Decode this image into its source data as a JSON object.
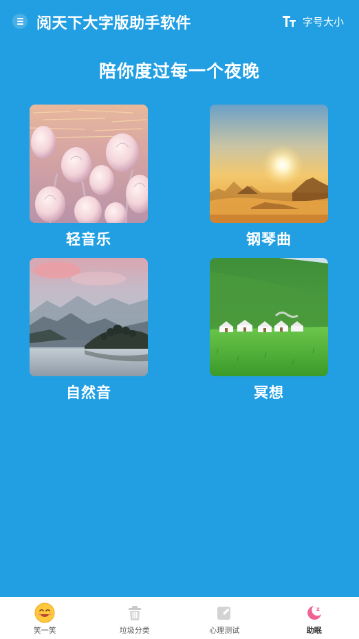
{
  "header": {
    "title": "阅天下大字版助手软件",
    "font_size_label": "字号大小"
  },
  "slogan": "陪你度过每一个夜晚",
  "cards": [
    {
      "label": "轻音乐"
    },
    {
      "label": "钢琴曲"
    },
    {
      "label": "自然音"
    },
    {
      "label": "冥想"
    }
  ],
  "bottom_nav": {
    "items": [
      {
        "label": "笑一笑",
        "icon": "smile-icon"
      },
      {
        "label": "垃圾分类",
        "icon": "trash-icon"
      },
      {
        "label": "心理测试",
        "icon": "edit-icon"
      },
      {
        "label": "助眠",
        "icon": "moon-sleep-icon",
        "active": true
      }
    ]
  },
  "colors": {
    "background": "#219fe2",
    "nav_background": "#ffffff",
    "active_icon": "#f06292"
  }
}
